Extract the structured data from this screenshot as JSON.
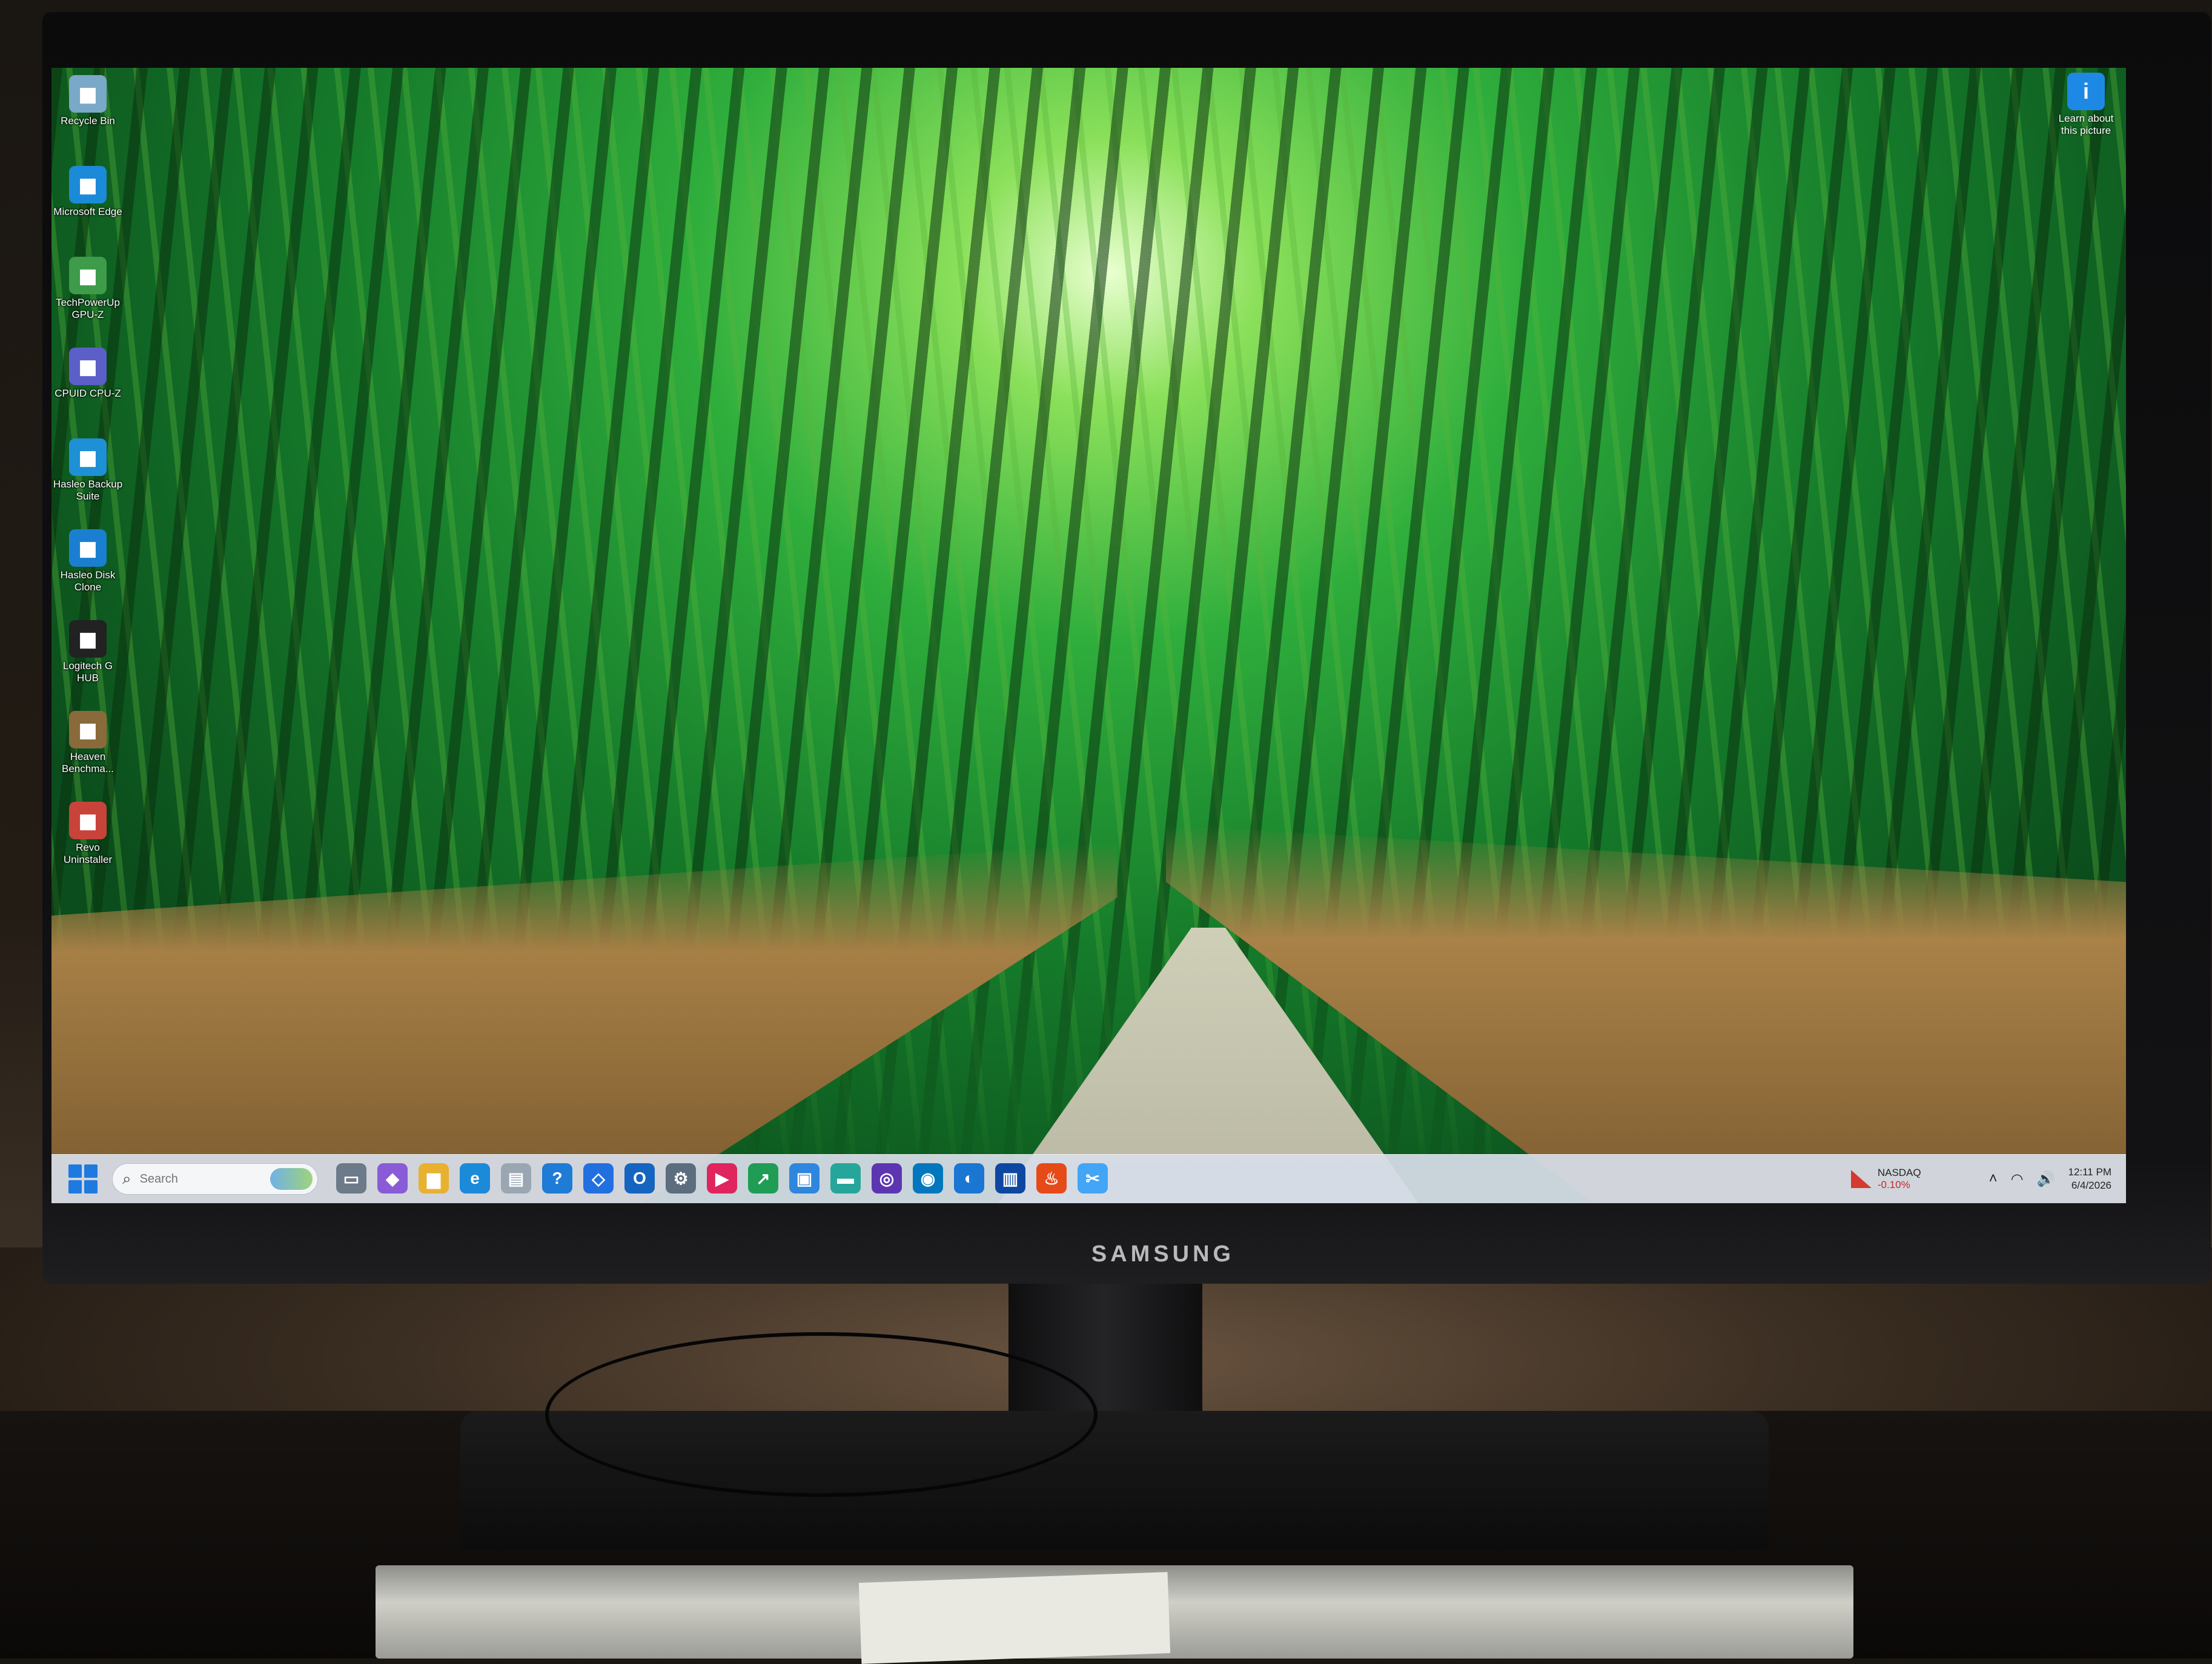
{
  "monitor": {
    "brand": "SAMSUNG"
  },
  "desktop_icons": [
    {
      "label": "Recycle Bin",
      "icon": "recycle-bin-icon",
      "color": "#7aa8c8"
    },
    {
      "label": "Microsoft Edge",
      "icon": "edge-icon",
      "color": "#1b8ad8"
    },
    {
      "label": "TechPowerUp GPU-Z",
      "icon": "gpu-z-icon",
      "color": "#3d9b4a"
    },
    {
      "label": "CPUID CPU-Z",
      "icon": "cpu-z-icon",
      "color": "#5b5fc7"
    },
    {
      "label": "Hasleo Backup Suite",
      "icon": "hasleo-backup-icon",
      "color": "#1e90d6"
    },
    {
      "label": "Hasleo Disk Clone",
      "icon": "hasleo-disk-clone-icon",
      "color": "#1a7fd0"
    },
    {
      "label": "Logitech G HUB",
      "icon": "logitech-ghub-icon",
      "color": "#222222"
    },
    {
      "label": "Heaven Benchma...",
      "icon": "heaven-benchmark-icon",
      "color": "#8a6a3a"
    },
    {
      "label": "Revo Uninstaller",
      "icon": "revo-uninstaller-icon",
      "color": "#c8433a"
    }
  ],
  "learn_about_picture": {
    "label": "Learn about this picture",
    "icon": "learn-about-picture-icon"
  },
  "taskbar": {
    "search_placeholder": "Search",
    "apps": [
      {
        "icon": "task-view-icon",
        "color": "#6c7a89",
        "glyph": "▭"
      },
      {
        "icon": "copilot-icon",
        "color": "#8a5bd6",
        "glyph": "◆"
      },
      {
        "icon": "file-explorer-icon",
        "color": "#e8b130",
        "glyph": "▆"
      },
      {
        "icon": "edge-icon",
        "color": "#1b8ad8",
        "glyph": "e"
      },
      {
        "icon": "notepad-icon",
        "color": "#9aa7b3",
        "glyph": "▤"
      },
      {
        "icon": "help-icon",
        "color": "#1e7bd6",
        "glyph": "?"
      },
      {
        "icon": "dropbox-icon",
        "color": "#2270e0",
        "glyph": "◇"
      },
      {
        "icon": "outlook-icon",
        "color": "#1565c0",
        "glyph": "O"
      },
      {
        "icon": "settings-icon",
        "color": "#5c6d7e",
        "glyph": "⚙"
      },
      {
        "icon": "media-player-icon",
        "color": "#e0245e",
        "glyph": "▶"
      },
      {
        "icon": "stocks-app-icon",
        "color": "#1f9d55",
        "glyph": "↗"
      },
      {
        "icon": "photos-icon",
        "color": "#2e86de",
        "glyph": "▣"
      },
      {
        "icon": "terminal-icon",
        "color": "#26a69a",
        "glyph": "▬"
      },
      {
        "icon": "hardware-monitor-icon",
        "color": "#5e35b1",
        "glyph": "◎"
      },
      {
        "icon": "disk-utility-icon",
        "color": "#0277bd",
        "glyph": "◉"
      },
      {
        "icon": "backup-icon",
        "color": "#1976d2",
        "glyph": "◐"
      },
      {
        "icon": "bar-chart-app-icon",
        "color": "#0d47a1",
        "glyph": "▥"
      },
      {
        "icon": "fire-app-icon",
        "color": "#e64a19",
        "glyph": "♨"
      },
      {
        "icon": "snipping-tool-icon",
        "color": "#42a5f5",
        "glyph": "✂"
      }
    ],
    "stock": {
      "name": "NASDAQ",
      "change": "-0.10%"
    },
    "clock": {
      "time": "12:11 PM",
      "date": "6/4/2026"
    }
  }
}
